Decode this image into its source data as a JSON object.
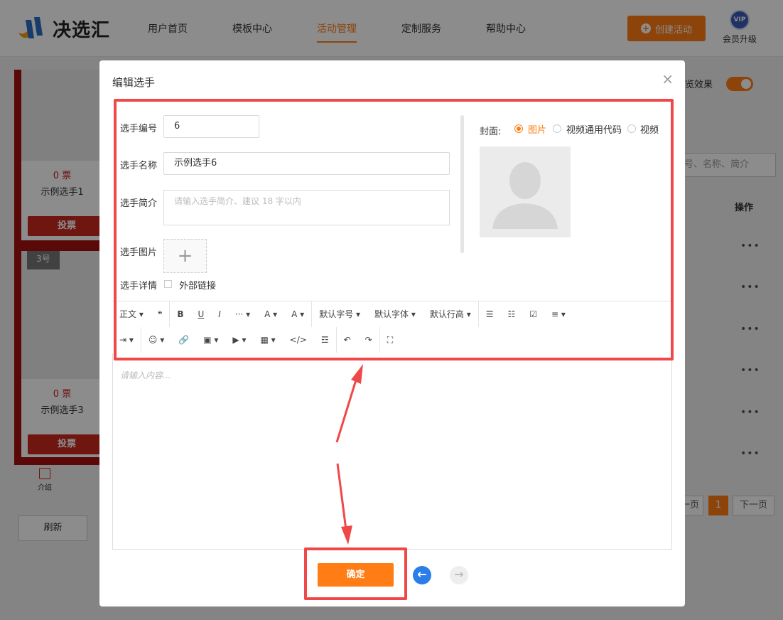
{
  "header": {
    "logo_text": "决选汇",
    "nav": [
      "用户首页",
      "模板中心",
      "活动管理",
      "定制服务",
      "帮助中心"
    ],
    "active_nav": "活动管理",
    "create_label": "创建活动",
    "vip_badge": "VIP",
    "vip_label": "会员升级"
  },
  "background": {
    "cards": [
      {
        "votes": "0 票",
        "name": "示例选手1",
        "vote_btn": "投票"
      },
      {
        "badge": "3号",
        "votes": "0 票",
        "name": "示例选手3",
        "vote_btn": "投票"
      }
    ],
    "intro_label": "介绍",
    "refresh_label": "刷新",
    "preview_label": "览效果",
    "search_placeholder": "号、名称、简介",
    "ops_header": "操作",
    "row_action": "•••",
    "pager": {
      "prev": "一页",
      "current": "1",
      "next": "下一页"
    }
  },
  "modal": {
    "title": "编辑选手",
    "close": "×",
    "fields": {
      "number_label": "选手编号",
      "number_value": "6",
      "name_label": "选手名称",
      "name_value": "示例选手6",
      "intro_label": "选手简介",
      "intro_placeholder": "请输入选手简介、建议 18 字以内",
      "image_label": "选手图片",
      "upload_plus": "+",
      "detail_label": "选手详情",
      "external_link_label": "外部链接"
    },
    "cover": {
      "label": "封面:",
      "options": [
        "图片",
        "视频通用代码",
        "视频"
      ],
      "selected": "图片"
    },
    "toolbar_row1": [
      "正文 ▾",
      "❝",
      "B",
      "U",
      "I",
      "··· ▾",
      "A ▾",
      "A ▾",
      "默认字号 ▾",
      "默认字体 ▾",
      "默认行高 ▾",
      "☰",
      "☷",
      "☑",
      "≡ ▾"
    ],
    "toolbar_row2": [
      "⇥ ▾",
      "☺ ▾",
      "🔗",
      "▣ ▾",
      "▶ ▾",
      "▦ ▾",
      "</>",
      "☲",
      "↶",
      "↷",
      "⛶"
    ],
    "editor_placeholder": "请输入内容...",
    "confirm_label": "确定",
    "prev_icon": "←",
    "next_icon": "→"
  },
  "colors": {
    "accent": "#ff7d14",
    "highlight_box": "#f04848",
    "vote_red": "#c8281c",
    "prev_blue": "#2b7de9"
  }
}
